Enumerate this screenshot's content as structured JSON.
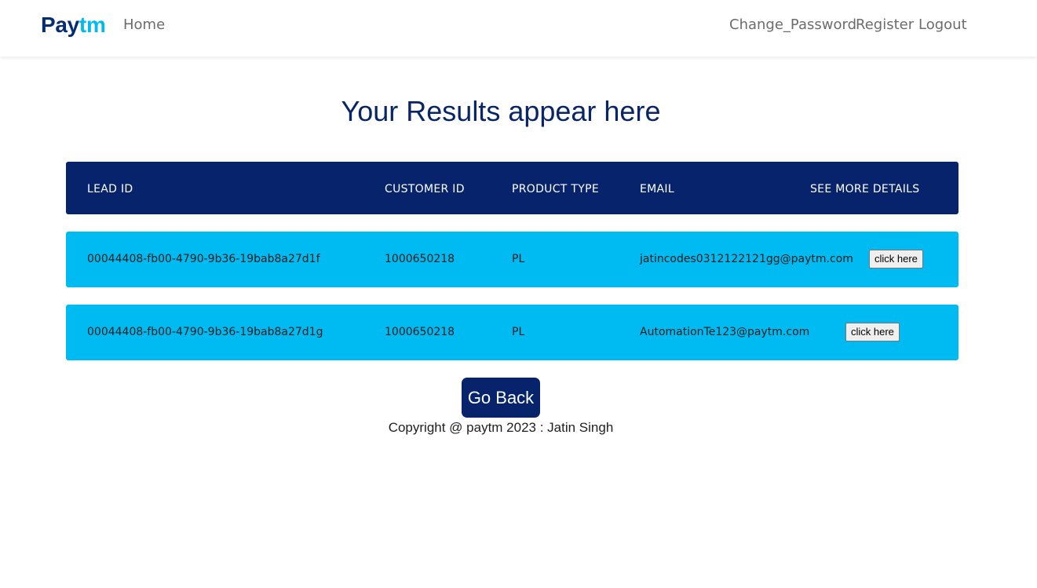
{
  "navbar": {
    "brand_part1": "Pay",
    "brand_part2": "tm",
    "home": "Home",
    "change_password": "Change_Password",
    "register": "Register",
    "logout": "Logout"
  },
  "page": {
    "title": "Your Results appear here"
  },
  "table": {
    "headers": [
      "LEAD ID",
      "CUSTOMER ID",
      "PRODUCT TYPE",
      "EMAIL",
      "SEE MORE DETAILS"
    ],
    "rows": [
      {
        "lead_id": "00044408-fb00-4790-9b36-19bab8a27d1f",
        "customer_id": "1000650218",
        "product_type": "PL",
        "email": "jatincodes0312122121gg@paytm.com",
        "details_label": "click here"
      },
      {
        "lead_id": "00044408-fb00-4790-9b36-19bab8a27d1g",
        "customer_id": "1000650218",
        "product_type": "PL",
        "email": "AutomationTe123@paytm.com",
        "details_label": "click here"
      }
    ]
  },
  "actions": {
    "go_back": "Go Back"
  },
  "footer": {
    "copyright": "Copyright @ paytm 2023 : Jatin Singh"
  },
  "colors": {
    "brand_navy": "#042e6f",
    "brand_sky": "#00baf2",
    "header_bg": "#07236b",
    "row_bg": "#00baf2",
    "title": "#082567"
  }
}
